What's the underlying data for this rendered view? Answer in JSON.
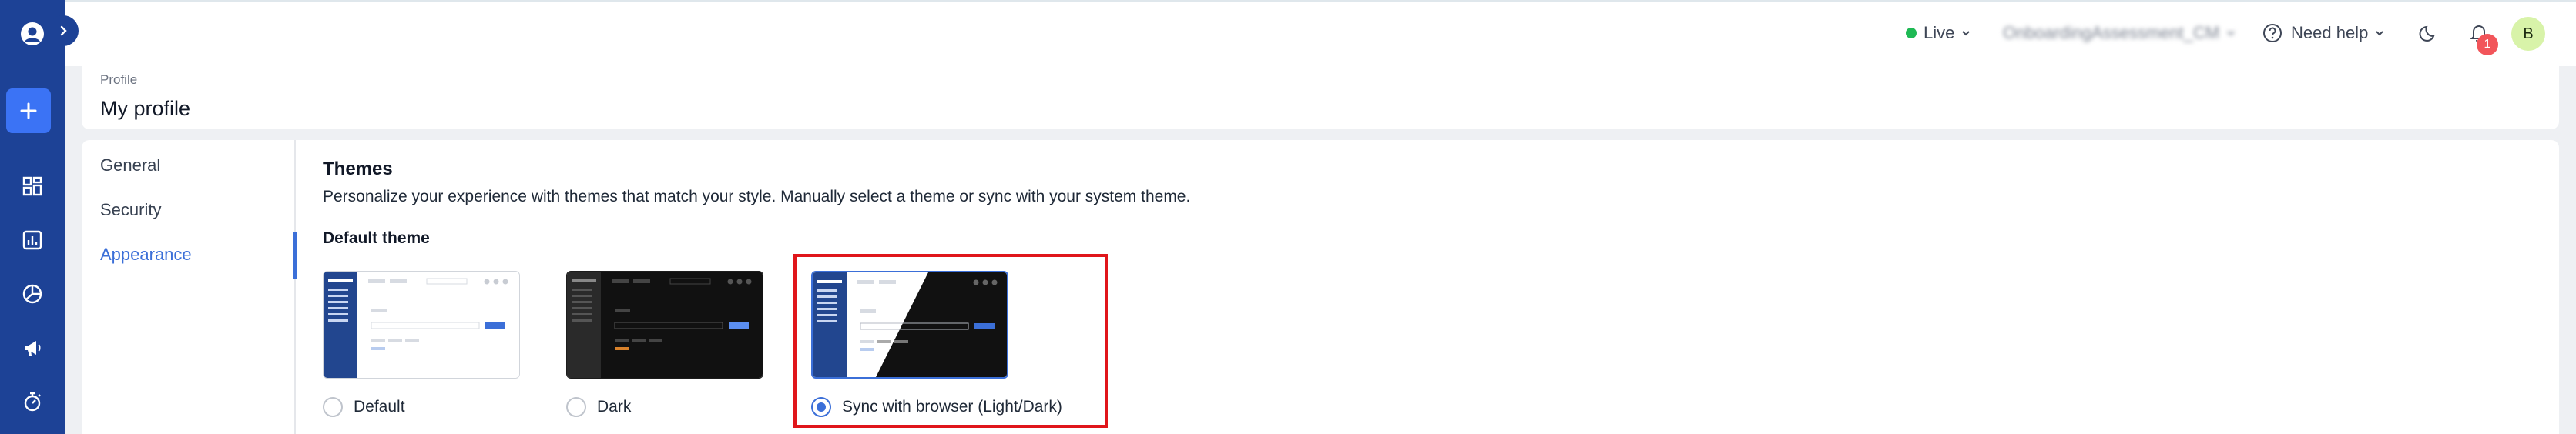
{
  "rail": {
    "icons": [
      "user-circle-icon",
      "plus-icon",
      "dashboard-icon",
      "reports-icon",
      "pie-chart-icon",
      "megaphone-icon",
      "stopwatch-icon"
    ]
  },
  "topbar": {
    "env_label": "Live",
    "account_name": "OnboardingAssessment_CM",
    "help_label": "Need help",
    "notification_count": "1",
    "avatar_initial": "B"
  },
  "header": {
    "breadcrumb": "Profile",
    "title": "My profile"
  },
  "tabs": [
    {
      "label": "General",
      "active": false
    },
    {
      "label": "Security",
      "active": false
    },
    {
      "label": "Appearance",
      "active": true
    }
  ],
  "themes": {
    "title": "Themes",
    "description": "Personalize your experience with themes that match your style. Manually select a theme or sync with your system theme.",
    "default_theme_label": "Default theme",
    "options": [
      {
        "label": "Default",
        "selected": false
      },
      {
        "label": "Dark",
        "selected": false
      },
      {
        "label": "Sync with browser (Light/Dark)",
        "selected": true
      }
    ]
  },
  "colors": {
    "rail": "#1d4296",
    "accent": "#3b6fd8",
    "live": "#1eb954",
    "highlight": "#e0161b",
    "badge": "#f2555a"
  }
}
